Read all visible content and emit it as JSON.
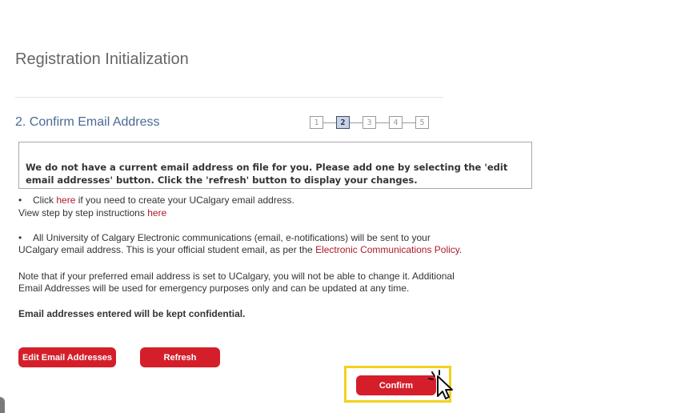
{
  "page": {
    "title": "Registration Initialization",
    "step_title": "2. Confirm Email Address"
  },
  "stepper": {
    "steps": [
      "1",
      "2",
      "3",
      "4",
      "5"
    ],
    "active_step": "2"
  },
  "notice": {
    "text": "We do not have a current email address on file for you. Please add one by selecting the 'edit email addresses' button. Click the 'refresh' button to display your changes."
  },
  "info": {
    "bullet_symbol": "•",
    "line1_prefix": "Click ",
    "line1_link": "here",
    "line1_suffix": " if you need to create your UCalgary email address.",
    "line2_prefix": "View step by step instructions ",
    "line2_link": "here",
    "line3": "All University of Calgary Electronic communications (email, e-notifications) will be sent to your",
    "line4_prefix": "UCalgary email address. This is your official student email, as per the ",
    "line4_link": "Electronic Communications Policy",
    "line4_suffix": ".",
    "note_line1": "Note that if your preferred email address is set to UCalgary, you will not be able to change it. Additional",
    "note_line2": "Email Addresses will be used for emergency purposes only and can be updated at any time.",
    "confidential": "Email addresses entered will be kept confidential."
  },
  "buttons": {
    "edit": "Edit Email Addresses",
    "refresh": "Refresh",
    "confirm": "Confirm"
  },
  "colors": {
    "button_red": "#d41f2b",
    "link_red": "#b0182a",
    "step_title_blue": "#4a6a94",
    "highlight_yellow": "#f3d11b"
  },
  "icons": {
    "cursor": "hand-pointer-click-icon"
  }
}
